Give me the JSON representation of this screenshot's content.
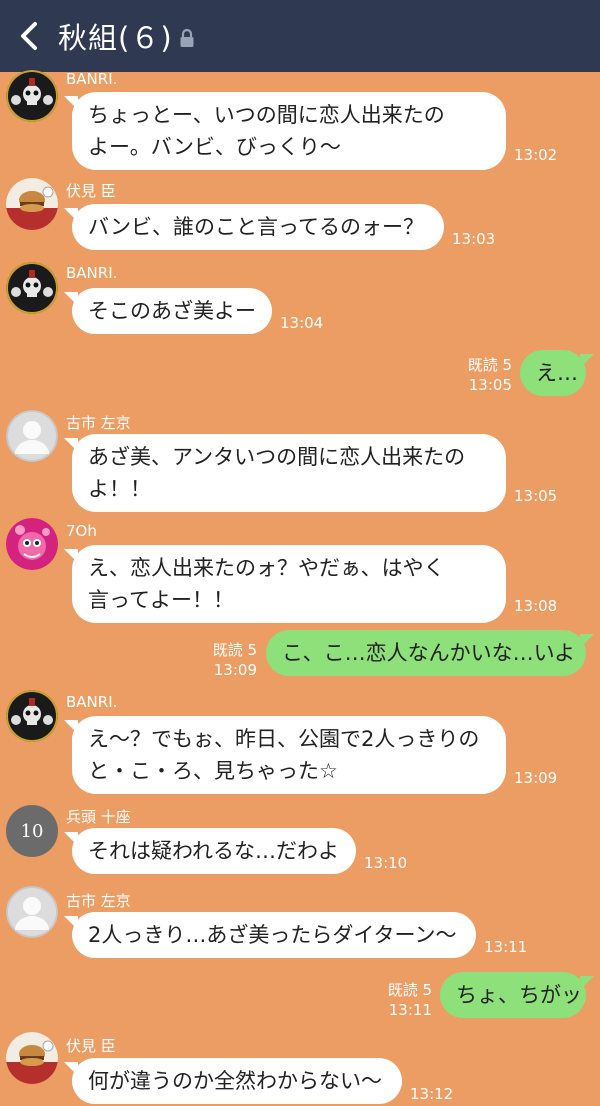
{
  "header": {
    "title": "秋組(６)"
  },
  "colors": {
    "background": "#ec9d63",
    "header": "#2f3a52",
    "incoming_bubble": "#ffffff",
    "outgoing_bubble": "#8ee07a"
  },
  "messages": [
    {
      "sender": "BANRI.",
      "lines": [
        "ちょっとー、いつの間に恋人出来たの",
        "よー。バンビ、びっくり〜"
      ],
      "time": "13:02"
    },
    {
      "sender": "伏見 臣",
      "lines": [
        "バンビ、誰のこと言ってるのォー？"
      ],
      "time": "13:03"
    },
    {
      "sender": "BANRI.",
      "lines": [
        "そこのあざ美よー"
      ],
      "time": "13:04"
    },
    {
      "read": "既読 5",
      "lines": [
        "え…"
      ],
      "time": "13:05"
    },
    {
      "sender": "古市 左京",
      "lines": [
        "あざ美、アンタいつの間に恋人出来たの",
        "よ！！"
      ],
      "time": "13:05"
    },
    {
      "sender": "7Oh",
      "lines": [
        "え、恋人出来たのォ？やだぁ、はやく",
        "言ってよー！！"
      ],
      "time": "13:08"
    },
    {
      "read": "既読 5",
      "lines": [
        "こ、こ…恋人なんかいな…いよ"
      ],
      "time": "13:09"
    },
    {
      "sender": "BANRI.",
      "lines": [
        "え〜？でもぉ、昨日、公園で2人っきりの",
        "と・こ・ろ、見ちゃった☆"
      ],
      "time": "13:09"
    },
    {
      "sender": "兵頭 十座",
      "avatar_text": "10",
      "lines": [
        "それは疑われるな…だわよ"
      ],
      "time": "13:10"
    },
    {
      "sender": "古市 左京",
      "lines": [
        "2人っきり…あざ美ったらダイターン〜"
      ],
      "time": "13:11"
    },
    {
      "read": "既読 5",
      "lines": [
        "ちょ、ちがッ"
      ],
      "time": "13:11"
    },
    {
      "sender": "伏見 臣",
      "lines": [
        "何が違うのか全然わからない〜"
      ],
      "time": "13:12"
    }
  ]
}
